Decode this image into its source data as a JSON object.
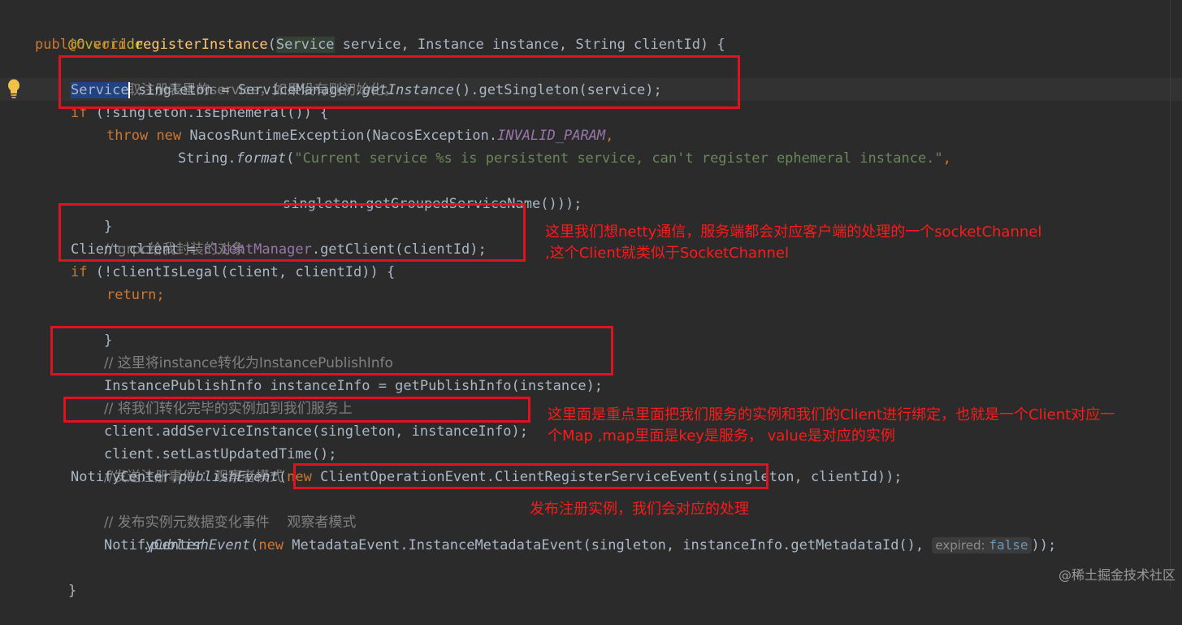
{
  "code": {
    "l1": {
      "annotation": "@Override"
    },
    "l2": {
      "public": "public",
      "void": "void",
      "name": "registerInstance",
      "t1": "Service",
      "p1": " service, ",
      "t2": "Instance",
      "p2": " instance, ",
      "t3": "String",
      "p3": " clientId) {"
    },
    "l3": {
      "comment": "//获取注册表里的service，如果没有则初始化，"
    },
    "l4": {
      "type": "Service",
      "rest": " singleton = ServiceManager.",
      "m1": "getInstance",
      "rest2": "().getSingleton(service);"
    },
    "l5": {
      "kw": "if",
      "rest": " (!singleton.isEphemeral()) {"
    },
    "l6": {
      "throw": "throw",
      "new": "new",
      "rest": " NacosRuntimeException(NacosException.",
      "const": "INVALID_PARAM",
      "comma": ","
    },
    "l7": {
      "pre": "String.",
      "m": "format",
      "open": "(",
      "str": "\"Current service %s is persistent service, can't register ephemeral instance.\"",
      "comma": ","
    },
    "l8": {
      "text": "singleton.getGroupedServiceName()));"
    },
    "l9": {
      "text": "}"
    },
    "l10": {
      "comment": "// grpc给我封装的对象"
    },
    "l11": {
      "pre": "Client client = ",
      "field": "clientManager",
      "rest": ".getClient(clientId);"
    },
    "l12": {
      "kw": "if",
      "rest": " (!clientIsLegal(client, clientId)) {"
    },
    "l13": {
      "kw": "return",
      "semi": ";"
    },
    "l14": {
      "text": "}"
    },
    "l15": {
      "comment": "// 这里将instance转化为InstancePublishInfo"
    },
    "l16": {
      "text": "InstancePublishInfo instanceInfo = getPublishInfo(instance);"
    },
    "l17": {
      "comment": "// 将我们转化完毕的实例加到我们服务上"
    },
    "l18": {
      "text": "client.addServiceInstance(singleton, instanceInfo);"
    },
    "l19": {
      "text": "client.setLastUpdatedTime();"
    },
    "l20": {
      "comment": "//发送注册事件 ：观察者模式"
    },
    "l21": {
      "pre": "NotifyCenter.",
      "m": "publishEvent",
      "open": "(",
      "new": "new",
      "rest": " ClientOperationEvent.ClientRegisterServiceEvent(singleton, clientId));"
    },
    "l22": {
      "comment": "// 发布实例元数据变化事件    观察者模式"
    },
    "l23": {
      "text": "NotifyCenter"
    },
    "l24": {
      "dot": ".",
      "m": "publishEvent",
      "open": "(",
      "new": "new",
      "rest": " MetadataEvent.InstanceMetadataEvent(singleton, instanceInfo.getMetadataId(), ",
      "hint_label": "expired:",
      "hint_value": "false",
      "close": "));"
    },
    "l25": {
      "text": "}"
    }
  },
  "notes": {
    "n1_line1": "这里我们想netty通信，服务端都会对应客户端的处理的一个socketChannel",
    "n1_line2": ",这个Client就类似于SocketChannel",
    "n2_line1": "这里面是重点里面把我们服务的实例和我们的Client进行绑定，也就是一个Client对应一",
    "n2_line2": "个Map ,map里面是key是服务，  value是对应的实例",
    "n3": "发布注册实例，我们会对应的处理"
  },
  "watermark": "@稀土掘金技术社区",
  "colors": {
    "annotation_red": "#e0121f",
    "keyword": "#cc7832",
    "string": "#6a8759",
    "comment": "#808080",
    "method": "#ffc66d",
    "field": "#9876aa",
    "background": "#2b2b2b"
  }
}
